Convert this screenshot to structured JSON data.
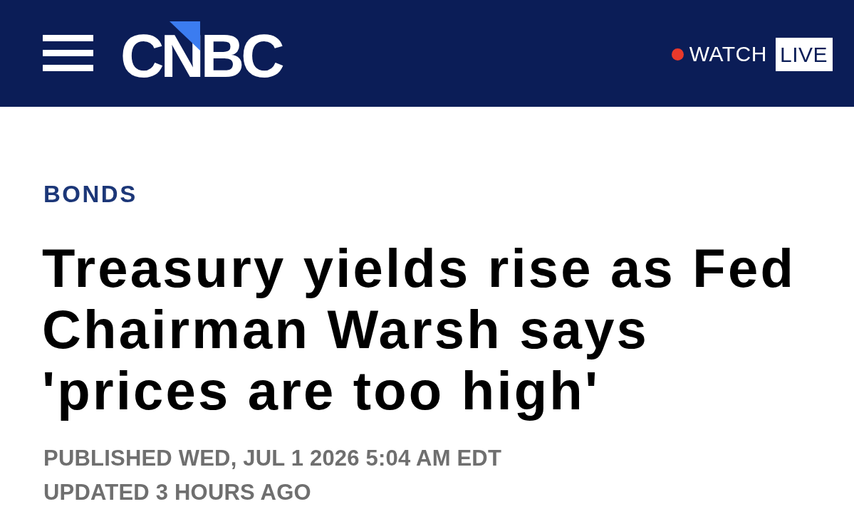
{
  "header": {
    "logo": "CNBC",
    "watch": {
      "label": "WATCH",
      "badge": "LIVE"
    }
  },
  "article": {
    "section": "BONDS",
    "headline": "Treasury yields rise as Fed Chairman Warsh says 'prices are too high'",
    "published": "PUBLISHED WED, JUL 1 2026 5:04 AM EDT",
    "updated": "UPDATED 3 HOURS AGO"
  }
}
